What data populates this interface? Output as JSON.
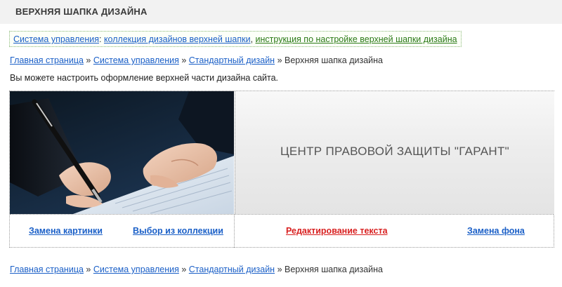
{
  "page_title": "ВЕРХНЯЯ ШАПКА ДИЗАЙНА",
  "info_links": {
    "first": "Система управления",
    "separator1": ": ",
    "second": "коллекция дизайнов верхней шапки",
    "separator2": ", ",
    "third": "инструкция по настройке верхней шапки дизайна"
  },
  "breadcrumb": {
    "home": "Главная страница",
    "control": "Система управления",
    "standard": "Стандартный дизайн",
    "current": "Верхняя шапка дизайна",
    "separator": "»"
  },
  "description": "Вы можете настроить оформление верхней части дизайна сайта.",
  "header_text": "ЦЕНТР ПРАВОВОЙ ЗАЩИТЫ \"ГАРАНТ\"",
  "controls": {
    "replace_image": "Замена картинки",
    "choose_from_collection": "Выбор из коллекции",
    "edit_text": "Редактирование текста",
    "replace_background": "Замена фона"
  },
  "image_alt_icon": "document-signing-photo"
}
